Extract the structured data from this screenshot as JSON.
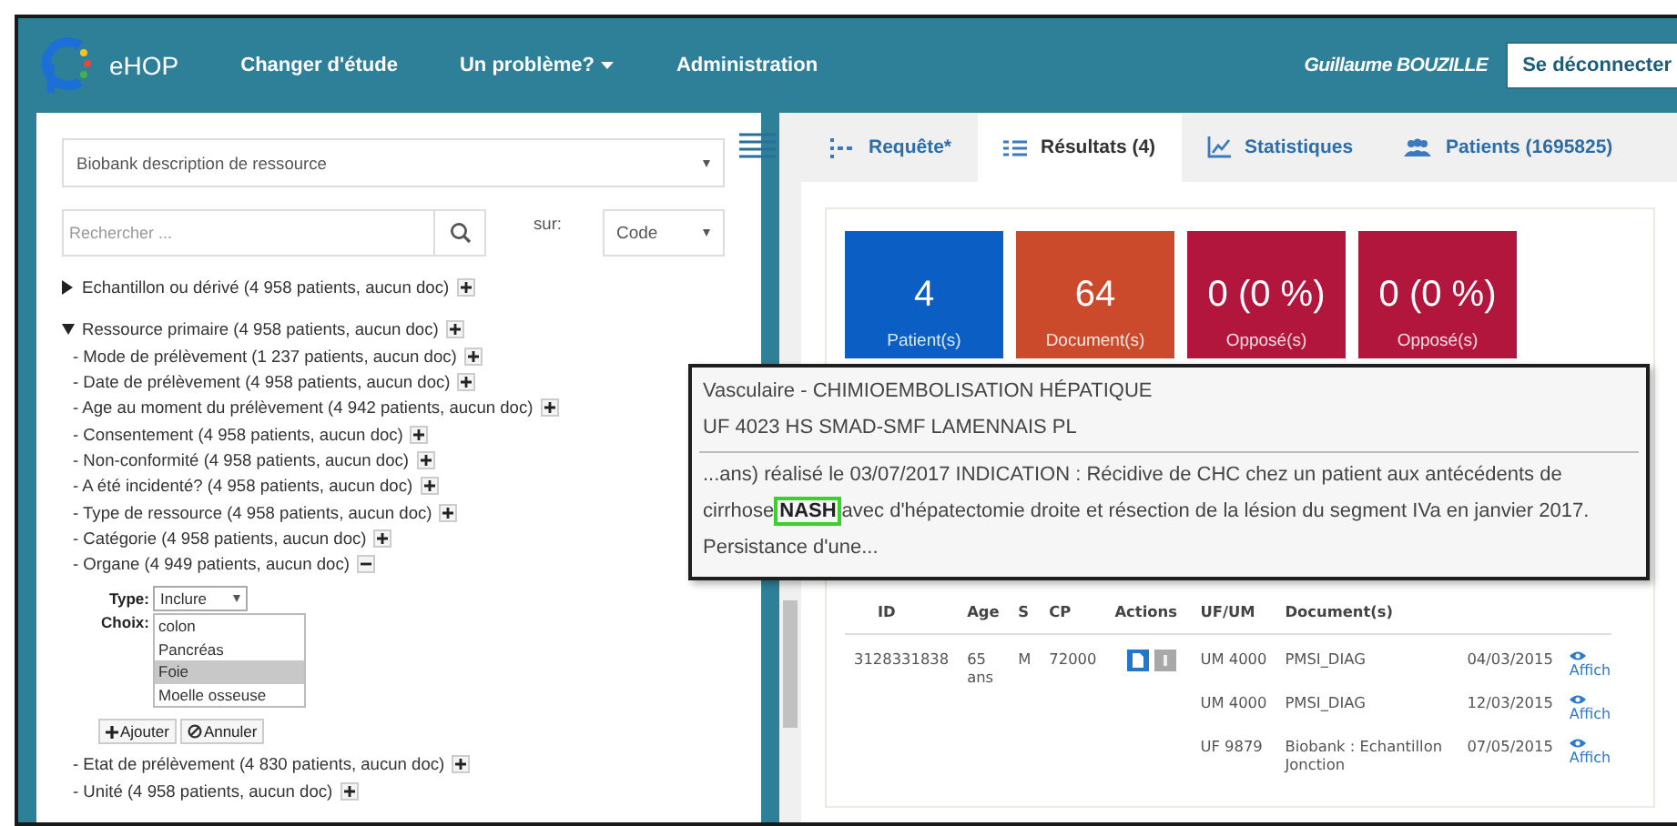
{
  "navbar": {
    "brand": "eHOP",
    "links": [
      {
        "label": "Changer d'étude",
        "dropdown": false
      },
      {
        "label": "Un problème?",
        "dropdown": true
      },
      {
        "label": "Administration",
        "dropdown": false
      }
    ],
    "user": "Guillaume BOUZILLE",
    "logout": "Se déconnecter"
  },
  "left": {
    "resource_select": "Biobank description de ressource",
    "search": {
      "placeholder": "Rechercher ..."
    },
    "search_on_label": "sur:",
    "search_on_value": "Code",
    "tree": [
      {
        "label": "Echantillon ou dérivé (4 958 patients, aucun doc)",
        "expanded": false
      },
      {
        "label": "Ressource primaire (4 958 patients, aucun doc)",
        "expanded": true,
        "children": [
          {
            "label": "- Mode de prélèvement (1 237 patients, aucun doc)",
            "expanded": false
          },
          {
            "label": "- Date de prélèvement (4 958 patients, aucun doc)",
            "expanded": false
          },
          {
            "label": "- Age au moment du prélèvement (4 942 patients, aucun doc)",
            "expanded": false
          },
          {
            "label": "- Consentement (4 958 patients, aucun doc)",
            "expanded": false
          },
          {
            "label": "- Non-conformité (4 958 patients, aucun doc)",
            "expanded": false
          },
          {
            "label": "- A été incidenté? (4 958 patients, aucun doc)",
            "expanded": false
          },
          {
            "label": "- Type de ressource (4 958 patients, aucun doc)",
            "expanded": false
          },
          {
            "label": "- Catégorie (4 958 patients, aucun doc)",
            "expanded": false
          },
          {
            "label": "- Organe (4 949 patients, aucun doc)",
            "expanded": true,
            "filter": {
              "type_label": "Type:",
              "type_value": "Inclure",
              "choice_label": "Choix:",
              "options": [
                {
                  "label": "colon",
                  "selected": false
                },
                {
                  "label": "Pancréas",
                  "selected": false
                },
                {
                  "label": "Foie",
                  "selected": true
                },
                {
                  "label": "Moelle osseuse",
                  "selected": false
                }
              ],
              "buttons": [
                {
                  "kind": "add",
                  "label": "Ajouter"
                },
                {
                  "kind": "cancel",
                  "label": "Annuler"
                }
              ]
            }
          },
          {
            "label": "- Etat de prélèvement (4 830 patients, aucun doc)",
            "expanded": false
          },
          {
            "label": "- Unité (4 958 patients, aucun doc)",
            "expanded": false
          }
        ]
      }
    ]
  },
  "tabs": [
    {
      "kind": "query",
      "label": "Requête*",
      "selected": false
    },
    {
      "kind": "results",
      "label": "Résultats (4)",
      "selected": true
    },
    {
      "kind": "stats",
      "label": "Statistiques",
      "selected": false
    },
    {
      "kind": "patients",
      "label": "Patients (1695825)",
      "selected": false
    }
  ],
  "stats": [
    {
      "value": "4",
      "label": "Patient(s)",
      "color": "#0b5fc4"
    },
    {
      "value": "64",
      "label": "Document(s)",
      "color": "#cc4a2c"
    },
    {
      "value": "0 (0 %)",
      "label": "Opposé(s)",
      "color": "#b3163c"
    },
    {
      "value": "0 (0 %)",
      "label": "Opposé(s)",
      "color": "#b3163c"
    }
  ],
  "tooltip": {
    "title": "Vasculaire - CHIMIOEMBOLISATION HÉPATIQUE",
    "subtitle": "UF 4023 HS SMAD-SMF LAMENNAIS PL",
    "text_before": "...ans) réalisé le 03/07/2017 INDICATION : Récidive de CHC chez un patient aux antécédents de cirrhose",
    "highlight": "NASH",
    "text_after": "avec d'hépatectomie droite et résection de la lésion du segment IVa en janvier 2017. Persistance d'une..."
  },
  "table": {
    "columns": [
      "ID",
      "Age",
      "S",
      "CP",
      "Actions",
      "UF/UM",
      "Document(s)"
    ],
    "rows": [
      {
        "id": "3128331838",
        "age": "65 ans",
        "sex": "M",
        "cp": "72000",
        "documents": [
          {
            "unit": "UM 4000",
            "name": "PMSI_DIAG",
            "date": "04/03/2015",
            "link": "Affich"
          },
          {
            "unit": "UM 4000",
            "name": "PMSI_DIAG",
            "date": "12/03/2015",
            "link": "Affich"
          },
          {
            "unit": "UF 9879",
            "name": "Biobank : Echantillon Jonction",
            "date": "07/05/2015",
            "link": "Affich"
          }
        ]
      }
    ]
  }
}
